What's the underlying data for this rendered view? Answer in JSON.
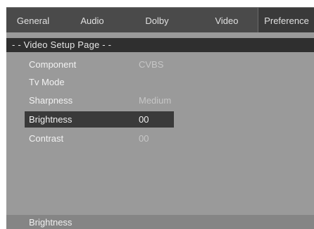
{
  "tabs": [
    "General",
    "Audio",
    "Dolby",
    "Video",
    "Preference"
  ],
  "selected_tab": "Preference",
  "page_title": "- - Video Setup Page - -",
  "menu": [
    {
      "label": "Component",
      "value": "CVBS"
    },
    {
      "label": "Tv Mode",
      "value": ""
    },
    {
      "label": "Sharpness",
      "value": "Medium"
    },
    {
      "label": "Brightness",
      "value": "00"
    },
    {
      "label": "Contrast",
      "value": "00"
    }
  ],
  "highlighted_item": "Brightness",
  "status_text": "Brightness",
  "colors": {
    "background": "#9a9a9a",
    "tab_bar": "#4a4a4a",
    "title_strip": "#2f2f2f",
    "highlight": "#3a3a3a",
    "status_bar": "#858585"
  }
}
